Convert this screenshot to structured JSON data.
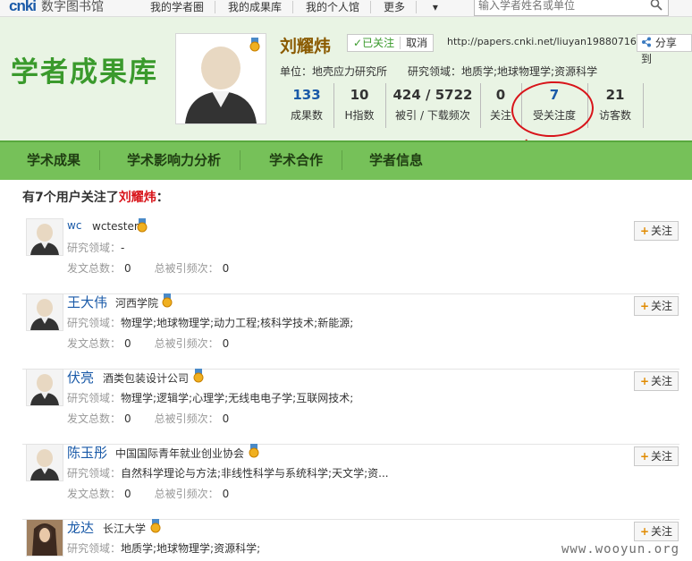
{
  "topbar": {
    "logo_text": "cnki",
    "logo_sub": "数字图书馆",
    "nav": [
      "我的学者圈",
      "我的成果库",
      "我的个人馆",
      "更多"
    ],
    "search_placeholder": "输入学者姓名或单位"
  },
  "header": {
    "brand": "学者成果库",
    "scholar_name": "刘耀炜",
    "follow_state": "已关注",
    "cancel_label": "取消",
    "profile_url": "http://papers.cnki.net/liuyan19880716",
    "share_label": "分享到",
    "unit_label": "单位：",
    "unit_value": "地壳应力研究所",
    "field_label": "研究领域：",
    "field_value": "地质学;地球物理学;资源科学",
    "stats": [
      {
        "value": "133",
        "label": "成果数"
      },
      {
        "value": "10",
        "label": "H指数"
      },
      {
        "value": "424 / 5722",
        "label": "被引 / 下载频次"
      },
      {
        "value": "0",
        "label": "关注"
      },
      {
        "value": "7",
        "label": "受关注度"
      },
      {
        "value": "21",
        "label": "访客数"
      }
    ]
  },
  "nav": {
    "items": [
      "学术成果",
      "学术影响力分析",
      "学术合作",
      "学者信息"
    ]
  },
  "followers": {
    "title_prefix": "有7个用户关注了",
    "title_name": "刘耀炜",
    "title_suffix": "：",
    "field_label": "研究领域：",
    "papers_label": "发文总数：",
    "cites_label": "总被引频次：",
    "follow_button": "关注",
    "list": [
      {
        "name": "wc",
        "org": "wctester",
        "field": "-",
        "papers": "0",
        "cites": "0"
      },
      {
        "name": "王大伟",
        "org": "河西学院",
        "field": "物理学;地球物理学;动力工程;核科学技术;新能源;",
        "papers": "0",
        "cites": "0"
      },
      {
        "name": "伏亮",
        "org": "酒类包装设计公司",
        "field": "物理学;逻辑学;心理学;无线电电子学;互联网技术;",
        "papers": "0",
        "cites": "0"
      },
      {
        "name": "陈玉彤",
        "org": "中国国际青年就业创业协会",
        "field": "自然科学理论与方法;非线性科学与系统科学;天文学;资...",
        "papers": "0",
        "cites": "0"
      },
      {
        "name": "龙达",
        "org": "长江大学",
        "field": "地质学;地球物理学;资源科学;",
        "papers": "",
        "cites": ""
      }
    ]
  },
  "watermark": "www.wooyun.org",
  "colors": {
    "brand_green": "#3a9a2c",
    "nav_green": "#76c159",
    "link_blue": "#1a5aa8",
    "highlight_red": "#d8141a",
    "name_brown": "#8a5a00"
  }
}
